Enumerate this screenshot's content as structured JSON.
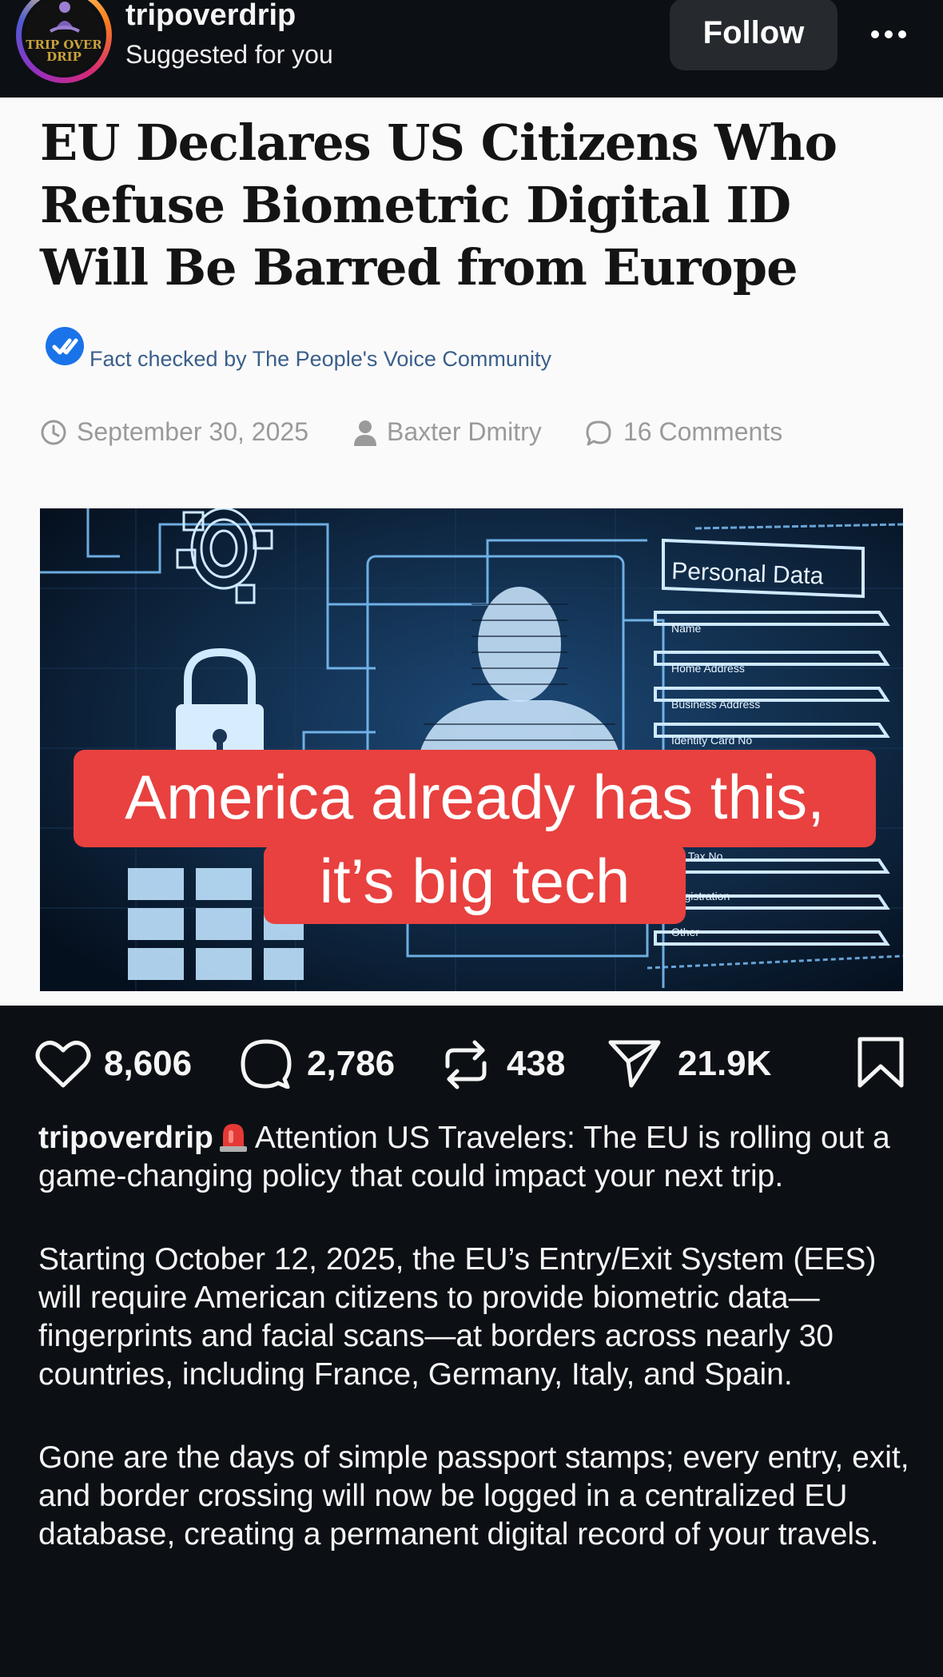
{
  "header": {
    "username": "tripoverdrip",
    "subtitle": "Suggested for you",
    "avatar_text_line1": "TRIP OVER",
    "avatar_text_line2": "DRIP",
    "follow_label": "Follow",
    "more_icon": "more-horizontal-icon"
  },
  "article": {
    "title": "EU Declares US Citizens Who Refuse Biometric Digital ID Will Be Barred from Europe",
    "fact_check": "Fact checked by The People's Voice Community",
    "date": "September 30, 2025",
    "author": "Baxter Dmitry",
    "comments": "16 Comments",
    "image": {
      "panel_title": "Personal Data",
      "fields": [
        "Name",
        "Home Address",
        "Business Address",
        "Identity Card No",
        "ome Tax No",
        "r Registration",
        "Other"
      ],
      "caption_line1": "America already has this,",
      "caption_line2": "it’s big tech"
    }
  },
  "actions": {
    "likes": "8,606",
    "comments": "2,786",
    "reposts": "438",
    "shares": "21.9K"
  },
  "post": {
    "username": "tripoverdrip",
    "paragraph1": "Attention US Travelers: The EU is rolling out a game-changing policy that could impact your next trip.",
    "paragraph2": "Starting October 12, 2025, the EU’s Entry/Exit System (EES) will require American citizens to provide biometric data—fingerprints and facial scans—at borders across nearly 30 countries, including France, Germany, Italy, and Spain.",
    "paragraph3": "Gone are the days of simple passport stamps; every entry, exit, and border crossing will now be logged in a centralized EU database, creating a permanent digital record of your travels."
  },
  "colors": {
    "background": "#0c1014",
    "card": "#fafafa",
    "caption_red": "#e8413f",
    "follow_bg": "#262a2f",
    "fact_blue": "#1a73e8"
  }
}
